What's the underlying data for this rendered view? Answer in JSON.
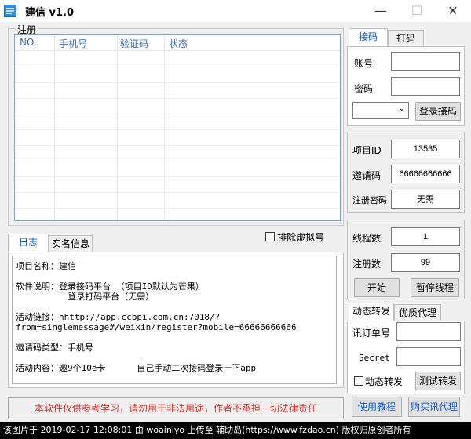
{
  "window": {
    "title": "建信 v1.0",
    "minimize": "—",
    "maximize": "☐",
    "close": "✕"
  },
  "register_group": {
    "label": "注册",
    "columns": [
      "NO.",
      "手机号",
      "验证码",
      "状态"
    ]
  },
  "right_tabs": {
    "tab1": "接码",
    "tab2": "打码"
  },
  "login": {
    "account_label": "账号",
    "account_value": "",
    "password_label": "密码",
    "password_value": "",
    "select_value": "",
    "login_button": "登录接码"
  },
  "project": {
    "id_label": "项目ID",
    "id_value": "13535",
    "invite_label": "邀请码",
    "invite_value": "66666666666",
    "regpwd_label": "注册密码",
    "regpwd_value": "无需"
  },
  "threads": {
    "thread_label": "线程数",
    "thread_value": "1",
    "count_label": "注册数",
    "count_value": "99",
    "start_button": "开始",
    "pause_button": "暂停线程"
  },
  "forward": {
    "tab1": "动态转发",
    "tab2": "优质代理",
    "order_label": "讯订单号",
    "order_value": "",
    "secret_label": "Secret",
    "secret_value": "",
    "dynamic_check_label": "动态转发",
    "test_button": "测试转发"
  },
  "log": {
    "tab1": "日志",
    "tab2": "实名信息",
    "exclude_virtual_label": "排除虚拟号",
    "lines": [
      "项目名称：建信",
      "",
      "软件说明：登录接码平台 （项目ID默认为芒果）",
      "          登录打码平台（无需）",
      "",
      "活动链接：hhttp://app.ccbpi.com.cn:7018/?",
      "from=singlemessage#/weixin/register?mobile=66666666666",
      "",
      "邀请码类型：手机号",
      "",
      "活动内容：邀9个10e卡      自己手动二次接码登录一下app"
    ]
  },
  "notice": {
    "text": "本软件仅供参考学习，请勿用于非法用途，作者不承担一切法律责任",
    "color": "#e0302a"
  },
  "bottom_buttons": {
    "tutorial": "使用教程",
    "buy_proxy": "购买讯代理"
  },
  "footer": {
    "text": "该图片于 2019-02-17 12:08:01 由 woainiyo 上传至 辅助岛(https://www.fzdao.cn) 版权归原创者所有"
  },
  "colors": {
    "accent": "#0c5ad6",
    "list_border": "#7aa7d9",
    "column_header": "#3b6fb6"
  }
}
